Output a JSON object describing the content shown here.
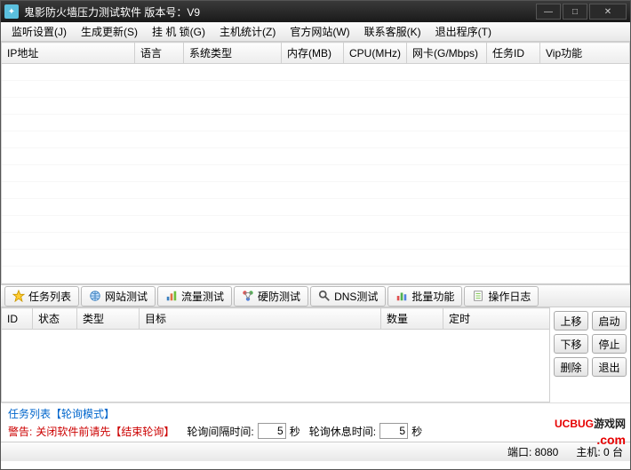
{
  "window": {
    "title": "鬼影防火墙压力测试软件  版本号：V9"
  },
  "menu": {
    "items": [
      "监听设置(J)",
      "生成更新(S)",
      "挂 机 锁(G)",
      "主机统计(Z)",
      "官方网站(W)",
      "联系客服(K)",
      "退出程序(T)"
    ]
  },
  "topTable": {
    "headers": [
      "IP地址",
      "语言",
      "系统类型",
      "内存(MB)",
      "CPU(MHz)",
      "网卡(G/Mbps)",
      "任务ID",
      "Vip功能"
    ]
  },
  "tabs": [
    {
      "label": "任务列表"
    },
    {
      "label": "网站测试"
    },
    {
      "label": "流量测试"
    },
    {
      "label": "硬防测试"
    },
    {
      "label": "DNS测试"
    },
    {
      "label": "批量功能"
    },
    {
      "label": "操作日志"
    }
  ],
  "bottomTable": {
    "headers": [
      "ID",
      "状态",
      "类型",
      "目标",
      "数量",
      "定时"
    ]
  },
  "sideButtons": {
    "up": "上移",
    "start": "启动",
    "down": "下移",
    "stop": "停止",
    "delete": "删除",
    "exit": "退出"
  },
  "infoRow": {
    "mode": "任务列表【轮询模式】",
    "warnLabel": "警告:",
    "warnText": "关闭软件前请先【结束轮询】",
    "intervalLabel": "轮询间隔时间:",
    "intervalValue": "5",
    "intervalUnit": "秒",
    "restLabel": "轮询休息时间:",
    "restValue": "5",
    "restUnit": "秒"
  },
  "status": {
    "port": "端口: 8080",
    "hosts": "主机: 0 台"
  },
  "watermark": {
    "t1": "UCBUG",
    "t2": "游戏网",
    "t3": ".com"
  }
}
